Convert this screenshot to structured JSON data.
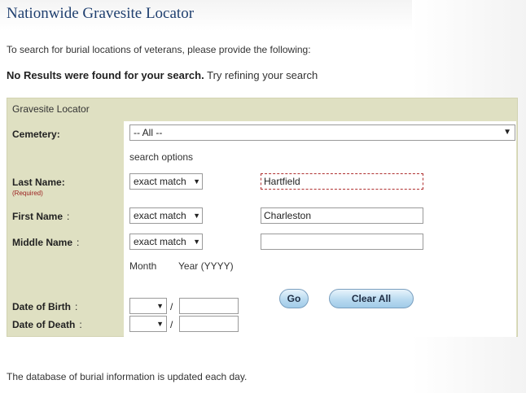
{
  "page": {
    "title": "Nationwide Gravesite Locator",
    "intro": "To search for burial locations of veterans, please provide the following:",
    "no_results_bold": "No Results were found for your search.",
    "no_results_rest": "Try refining your search",
    "footer": "The database of burial information is updated each day."
  },
  "form": {
    "header": "Gravesite Locator",
    "cemetery": {
      "label": "Cemetery:",
      "value": "-- All --"
    },
    "search_options_label": "search options",
    "last_name": {
      "label": "Last Name:",
      "required": "(Required)",
      "match": "exact match",
      "value": "Hartfield"
    },
    "first_name": {
      "label": "First Name",
      "colon": ":",
      "match": "exact match",
      "value": "Charleston"
    },
    "middle_name": {
      "label": "Middle Name",
      "colon": ":",
      "match": "exact match",
      "value": ""
    },
    "month_label": "Month",
    "year_label": "Year (YYYY)",
    "date_of_birth": {
      "label": "Date of Birth",
      "colon": ":",
      "month": "",
      "slash": "/",
      "year": ""
    },
    "date_of_death": {
      "label": "Date of Death",
      "colon": ":",
      "month": "",
      "slash": "/",
      "year": ""
    },
    "go_button": "Go",
    "clear_button": "Clear All"
  },
  "icons": {
    "dropdown": "dropdown-arrow-icon"
  }
}
